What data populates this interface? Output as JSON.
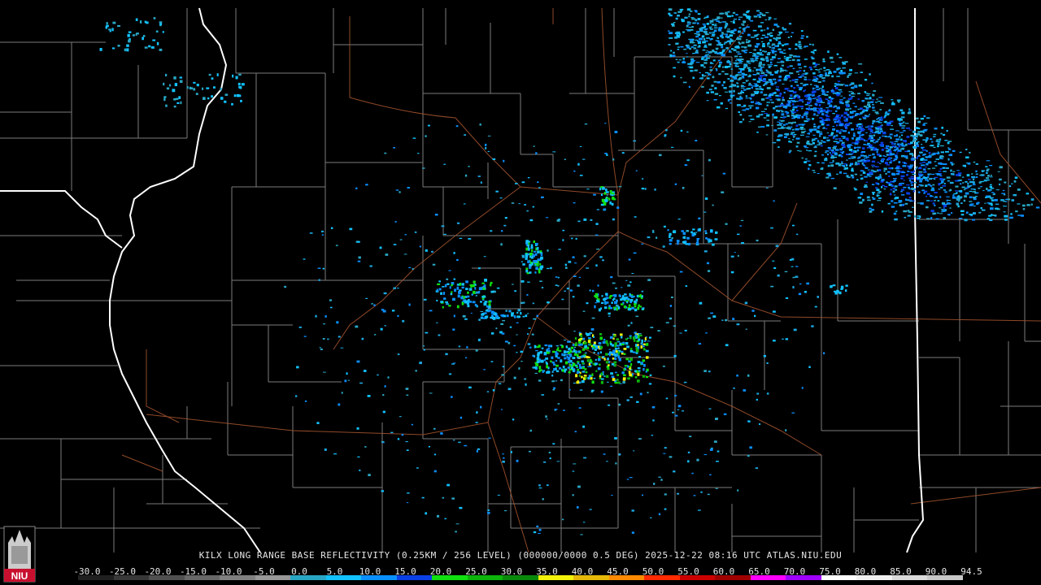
{
  "product": {
    "caption": "KILX LONG RANGE BASE REFLECTIVITY (0.25KM / 256 LEVEL) (000000/0000 0.5 DEG) 2025-12-22 08:16 UTC  ATLAS.NIU.EDU"
  },
  "scale": {
    "labels": [
      "-30.0",
      "-25.0",
      "-20.0",
      "-15.0",
      "-10.0",
      "-5.0",
      "0.0",
      "5.0",
      "10.0",
      "15.0",
      "20.0",
      "25.0",
      "30.0",
      "35.0",
      "40.0",
      "45.0",
      "50.0",
      "55.0",
      "60.0",
      "65.0",
      "70.0",
      "75.0",
      "80.0",
      "85.0",
      "90.0",
      "94.5"
    ],
    "colors": [
      "#202020",
      "#383838",
      "#505050",
      "#686868",
      "#808080",
      "#989898",
      "#29a6c4",
      "#12c2ff",
      "#0a8fff",
      "#0a40e6",
      "#10e010",
      "#0cb40c",
      "#0a8a0a",
      "#f2f20a",
      "#e6b80a",
      "#ff8a00",
      "#ff2a00",
      "#cc0000",
      "#a00000",
      "#ff00ff",
      "#a000ff",
      "#ffffff",
      "#f0f0f0",
      "#dadada",
      "#c8c8c8"
    ]
  },
  "logo": {
    "text": "NIU",
    "color": "#c8102e"
  }
}
